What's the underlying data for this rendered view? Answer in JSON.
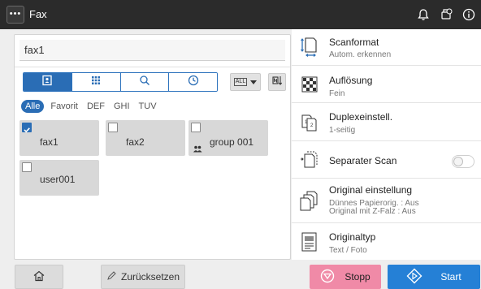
{
  "header": {
    "menu_icon": "ellipsis-icon",
    "title": "Fax",
    "icons": [
      "bell-icon",
      "device-status-icon",
      "info-icon"
    ]
  },
  "destination": {
    "value": "fax1"
  },
  "view_tabs": [
    "contacts-book-icon",
    "keypad-icon",
    "search-icon",
    "history-icon"
  ],
  "filter_dropdown": {
    "label": "ALL"
  },
  "filters": [
    "Alle",
    "Favorit",
    "DEF",
    "GHI",
    "TUV"
  ],
  "contacts": [
    {
      "name": "fax1",
      "checked": true
    },
    {
      "name": "fax2",
      "checked": false
    },
    {
      "name": "group 001",
      "checked": false,
      "group_icon": "group-icon"
    },
    {
      "name": "user001",
      "checked": false
    }
  ],
  "settings": [
    {
      "title": "Scanformat",
      "sub": "Autom. erkennen",
      "icon": "scan-size-icon"
    },
    {
      "title": "Auflösung",
      "sub": "Fein",
      "icon": "resolution-icon"
    },
    {
      "title": "Duplexeinstell.",
      "sub": "1-seitig",
      "icon": "duplex-icon"
    },
    {
      "title": "Separater Scan",
      "sub": "",
      "icon": "separate-scan-icon",
      "toggle": false
    },
    {
      "title": "Original einstellung",
      "sub": "Dünnes Papierorig. : Aus",
      "sub2": "Original mit Z-Falz : Aus",
      "icon": "original-setting-icon"
    },
    {
      "title": "Originaltyp",
      "sub": "Text / Foto",
      "icon": "original-type-icon"
    }
  ],
  "footer": {
    "home_icon": "home-icon",
    "reset_label": "Zurücksetzen",
    "stop_label": "Stopp",
    "start_label": "Start"
  },
  "colors": {
    "accent": "#2a6db5",
    "start": "#2580d6",
    "stop": "#f08aa7",
    "topbar": "#2b2b2b"
  }
}
